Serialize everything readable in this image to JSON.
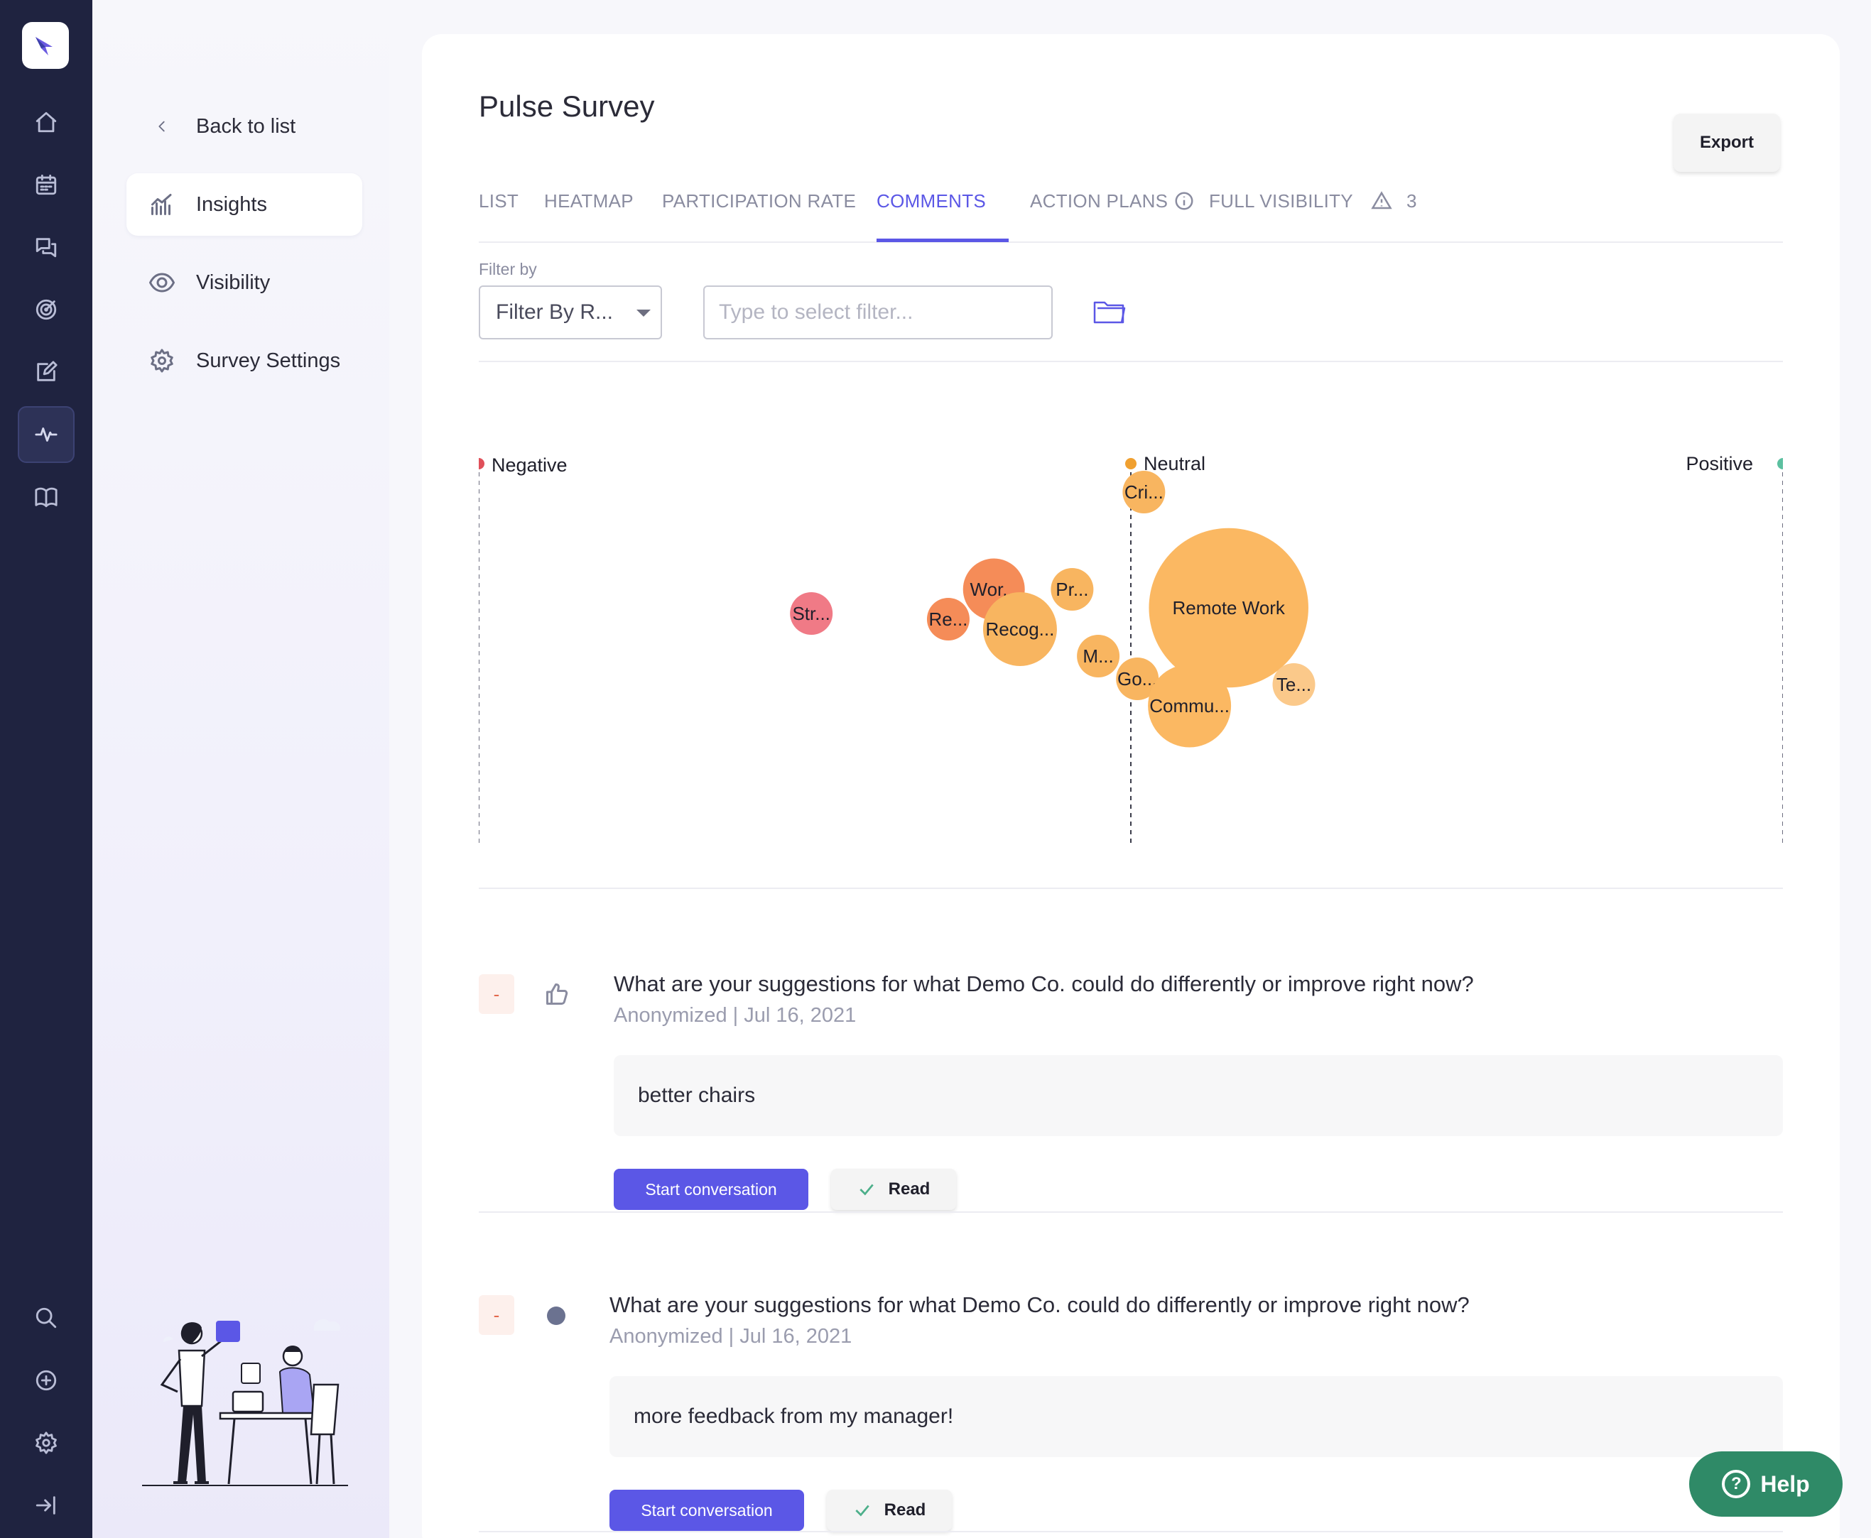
{
  "sidebar": {
    "back_label": "Back to list",
    "items": [
      {
        "label": "Insights"
      },
      {
        "label": "Visibility"
      },
      {
        "label": "Survey Settings"
      }
    ]
  },
  "header": {
    "title": "Pulse Survey",
    "export_label": "Export",
    "tabs": [
      {
        "label": "LIST"
      },
      {
        "label": "HEATMAP"
      },
      {
        "label": "PARTICIPATION RATE"
      },
      {
        "label": "COMMENTS",
        "active": true
      },
      {
        "label": "ACTION PLANS"
      },
      {
        "label": "FULL VISIBILITY"
      },
      {
        "label": "3"
      }
    ]
  },
  "filter": {
    "label": "Filter by",
    "select_value": "Filter By R...",
    "input_placeholder": "Type to select filter..."
  },
  "chart_data": {
    "type": "scatter",
    "axis_labels": {
      "negative": "Negative",
      "neutral": "Neutral",
      "positive": "Positive"
    },
    "x_range": [
      -1,
      1
    ],
    "colors": {
      "negative": "#e0505a",
      "neutral": "#f0a030",
      "positive": "#5cc0a0"
    },
    "bubbles": [
      {
        "label": "Cri...",
        "sentiment": 0.02,
        "size": 1.0,
        "color": "#f8b560"
      },
      {
        "label": "Remote Work",
        "sentiment": 0.15,
        "size": 14.0,
        "color": "#fbb862"
      },
      {
        "label": "Pr...",
        "sentiment": -0.09,
        "size": 1.0,
        "color": "#f8b560"
      },
      {
        "label": "Wor...",
        "sentiment": -0.21,
        "size": 2.1,
        "color": "#f58c58"
      },
      {
        "label": "Str...",
        "sentiment": -0.49,
        "size": 1.0,
        "color": "#f07a86"
      },
      {
        "label": "Re...",
        "sentiment": -0.28,
        "size": 1.0,
        "color": "#f58c58"
      },
      {
        "label": "Recog...",
        "sentiment": -0.17,
        "size": 3.0,
        "color": "#f8b560"
      },
      {
        "label": "M...",
        "sentiment": -0.05,
        "size": 1.0,
        "color": "#f8b560"
      },
      {
        "label": "Go...",
        "sentiment": 0.01,
        "size": 1.0,
        "color": "#f8b560"
      },
      {
        "label": "Te...",
        "sentiment": 0.25,
        "size": 1.0,
        "color": "#fbc98a"
      },
      {
        "label": "Commu...",
        "sentiment": 0.09,
        "size": 3.8,
        "color": "#fbb862"
      }
    ]
  },
  "comments": [
    {
      "sentiment": "-",
      "question": "What are your suggestions for what Demo Co. could do differently or improve right now?",
      "author": "Anonymized",
      "date": "Jul 16, 2021",
      "meta": "Anonymized  |  Jul 16, 2021",
      "answer": "better chairs",
      "primary_label": "Start conversation",
      "read_label": "Read"
    },
    {
      "sentiment": "-",
      "question": "What are your suggestions for what Demo Co. could do differently or improve right now?",
      "author": "Anonymized",
      "date": "Jul 16, 2021",
      "meta": "Anonymized  |  Jul 16, 2021",
      "answer": "more feedback from my manager!",
      "primary_label": "Start conversation",
      "read_label": "Read"
    }
  ],
  "help": {
    "label": "Help"
  }
}
